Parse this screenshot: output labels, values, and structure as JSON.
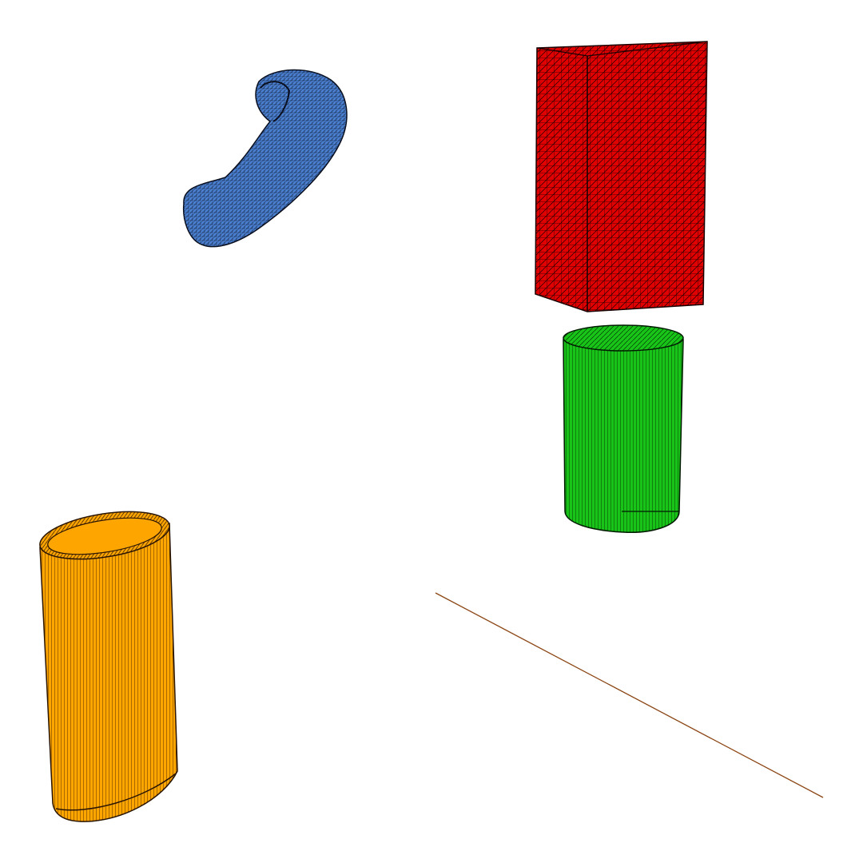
{
  "scene": {
    "background": "#ffffff",
    "objects": [
      {
        "name": "torus-segment",
        "shape": "curved tube",
        "color": "#4a7fd0"
      },
      {
        "name": "box",
        "shape": "rectangular prism",
        "color": "#e00000"
      },
      {
        "name": "cylinder",
        "shape": "solid cylinder",
        "color": "#19c419"
      },
      {
        "name": "hollow-tube",
        "shape": "hollow cylinder",
        "color": "#ffa500"
      },
      {
        "name": "line",
        "shape": "line segment",
        "color": "#8b4513"
      }
    ]
  }
}
